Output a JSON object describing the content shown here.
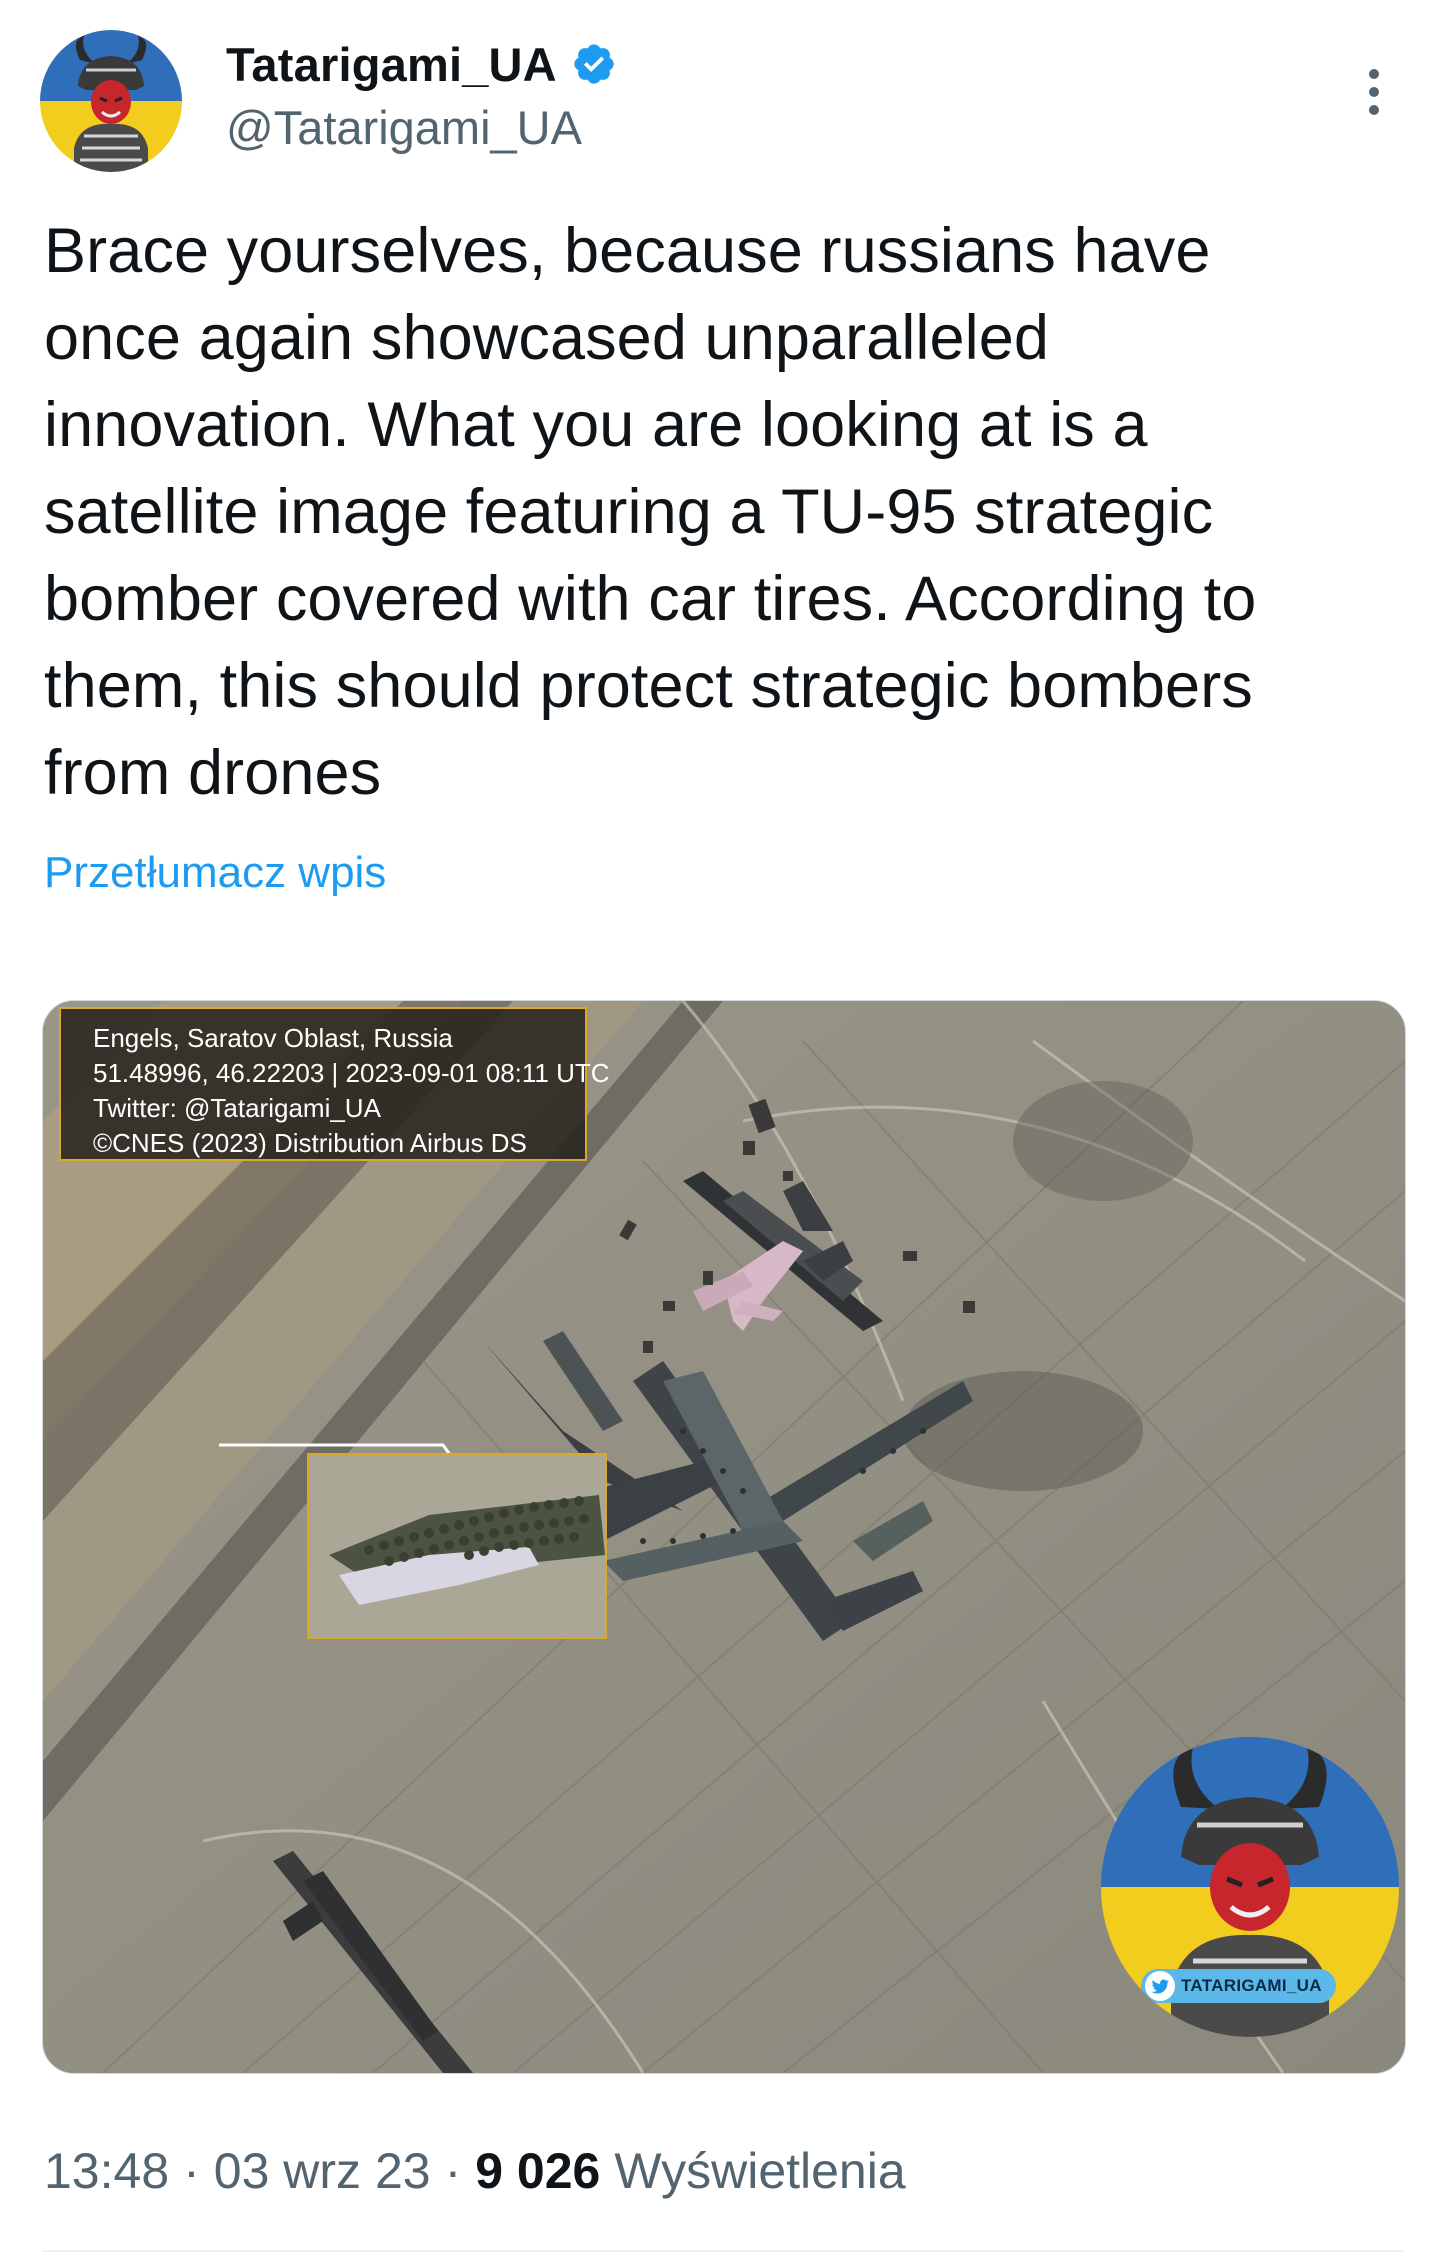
{
  "author": {
    "display_name": "Tatarigami_UA",
    "handle": "@Tatarigami_UA",
    "verified": true,
    "verified_color": "#1d9bf0",
    "avatar_icon": "samurai-avatar-icon"
  },
  "tweet": {
    "text": "Brace yourselves, because russians have\nonce again showcased unparalleled\ninnovation. What you are looking at is a\nsatellite image featuring a TU-95 strategic\nbomber covered with car tires. According to\nthem, this should protect strategic bombers\nfrom drones",
    "translate_label": "Przetłumacz wpis"
  },
  "media": {
    "info_box": {
      "line1": "Engels, Saratov Oblast, Russia",
      "line2": "51.48996, 46.22203 | 2023-09-01 08:11 UTC",
      "line3": "Twitter: @Tatarigami_UA",
      "line4": "©CNES (2023) Distribution Airbus DS"
    },
    "badge_label": "TATARIGAMI_UA",
    "accent_color": "#d9a82a"
  },
  "footer": {
    "time": "13:48",
    "date": "03 wrz 23",
    "views_count": "9 026",
    "views_label": "Wyświetlenia",
    "separator": "·"
  },
  "colors": {
    "text": "#0f1419",
    "secondary": "#536471",
    "link": "#1d9bf0"
  }
}
